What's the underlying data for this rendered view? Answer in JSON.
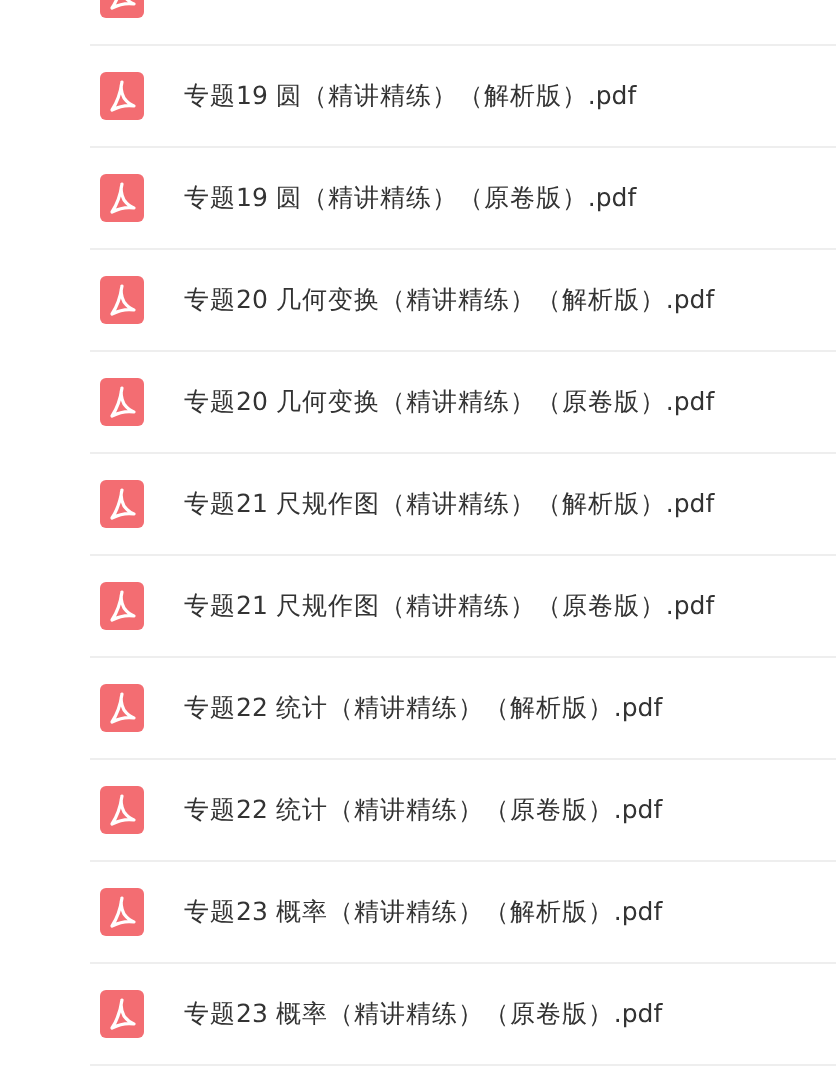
{
  "files": [
    {
      "kind": "partial"
    },
    {
      "kind": "file",
      "name": "专题19 圆（精讲精练）（解析版）.pdf"
    },
    {
      "name": "专题19 圆（精讲精练）（原卷版）.pdf"
    },
    {
      "name": "专题20 几何变换（精讲精练）（解析版）.pdf"
    },
    {
      "name": "专题20 几何变换（精讲精练）（原卷版）.pdf"
    },
    {
      "name": "专题21 尺规作图（精讲精练）（解析版）.pdf"
    },
    {
      "name": "专题21 尺规作图（精讲精练）（原卷版）.pdf"
    },
    {
      "name": "专题22 统计（精讲精练）（解析版）.pdf"
    },
    {
      "name": "专题22 统计（精讲精练）（原卷版）.pdf"
    },
    {
      "name": "专题23 概率（精讲精练）（解析版）.pdf"
    },
    {
      "name": "专题23 概率（精讲精练）（原卷版）.pdf"
    }
  ]
}
